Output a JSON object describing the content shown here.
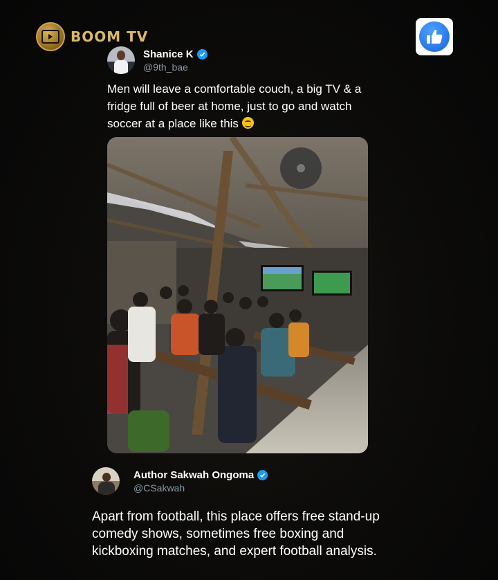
{
  "brand": {
    "name": "BOOM TV",
    "accent": "#d8b96a"
  },
  "like_button": {
    "icon": "thumbs-up-icon",
    "color": "#1b63d9"
  },
  "tweet": {
    "author": {
      "display_name": "Shanice K",
      "handle": "@9th_bae",
      "verified": true
    },
    "text": "Men will leave a comfortable couch, a big TV & a fridge full of beer at home, just to go and watch soccer at a place like this",
    "emoji": "grinning-face-emoji",
    "media": "photo of men watching soccer on two TVs in a shed"
  },
  "reply": {
    "author": {
      "display_name": "Author Sakwah Ongoma",
      "handle": "@CSakwah",
      "verified": true
    },
    "text": "Apart from football, this place offers free stand-up comedy shows, sometimes free boxing and kickboxing matches, and expert football analysis."
  },
  "colors": {
    "verified": "#1d9bf0",
    "handle": "#8b98a5",
    "background": "#0b0b0b"
  }
}
